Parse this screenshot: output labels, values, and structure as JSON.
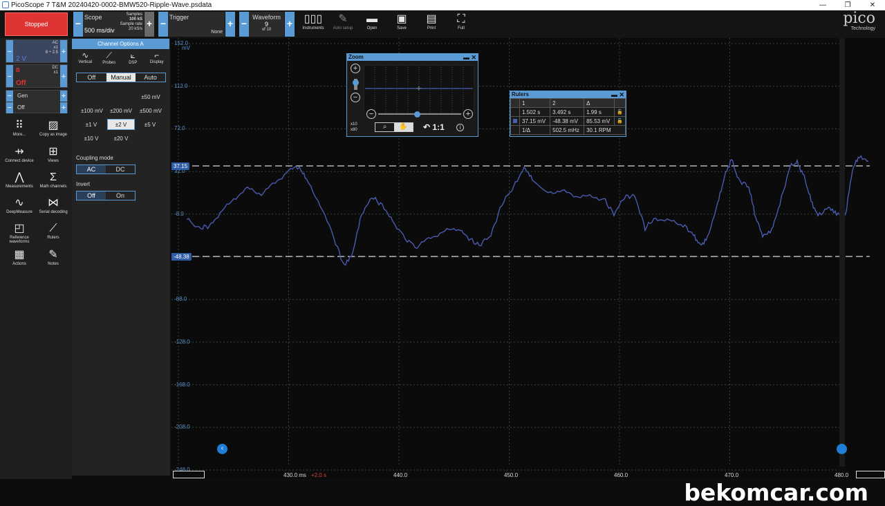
{
  "window": {
    "title": "PicoScope 7 T&M 20240420-0002-BMW520-Ripple-Wave.psdata",
    "min": "—",
    "restore": "❐",
    "close": "✕"
  },
  "toolbar": {
    "status": "Stopped",
    "scope": {
      "label": "Scope",
      "timebase": "500 ms/div",
      "samples_label": "Samples",
      "samples": "100 kS",
      "rate_label": "Sample rate",
      "rate": "20 kS/s"
    },
    "trigger": {
      "label": "Trigger",
      "mode": "None"
    },
    "waveform": {
      "label": "Waveform",
      "index": "9",
      "of": "of 10"
    },
    "tools": [
      "Instruments",
      "Auto setup",
      "Open",
      "Save",
      "Print",
      "Full"
    ],
    "brand": "pico",
    "brand_sub": "Technology"
  },
  "channels": {
    "a": {
      "coupling": "AC",
      "probe": "x1",
      "offset": "8 ÷ 2.5",
      "range": "2 V"
    },
    "b": {
      "letter": "B",
      "coupling": "DC",
      "probe": "x1",
      "state": "Off"
    },
    "gen": {
      "label": "Gen",
      "state": "Off"
    }
  },
  "nav": [
    {
      "label": "More..."
    },
    {
      "label": "Copy as image"
    },
    {
      "label": "Connect device"
    },
    {
      "label": "Views"
    },
    {
      "label": "Measurements"
    },
    {
      "label": "Math channels"
    },
    {
      "label": "DeepMeasure"
    },
    {
      "label": "Serial decoding"
    },
    {
      "label": "Reference waveforms"
    },
    {
      "label": "Rulers"
    },
    {
      "label": "Actions"
    },
    {
      "label": "Notes"
    }
  ],
  "channel_options": {
    "title": "Channel Options  A",
    "tabs": [
      "Vertical",
      "Probes",
      "DSP",
      "Display"
    ],
    "mode": [
      "Off",
      "Manual",
      "Auto"
    ],
    "mode_selected": "Manual",
    "ranges": [
      "±50 mV",
      "±100 mV",
      "±200 mV",
      "±500 mV",
      "±1 V",
      "±2 V",
      "±5 V",
      "±10 V",
      "±20 V"
    ],
    "range_selected": "±2 V",
    "coupling_label": "Coupling mode",
    "coupling": [
      "AC",
      "DC"
    ],
    "invert_label": "Invert",
    "invert": [
      "Off",
      "On"
    ]
  },
  "scope": {
    "unit": "mV",
    "y_ticks": [
      "152.0",
      "112.0",
      "72.0",
      "32.0",
      "-8.0",
      "-48.0",
      "-88.0",
      "-128.0",
      "-168.0",
      "-208.0",
      "-248.0"
    ],
    "x_ticks": [
      "430.0 ms",
      "440.0",
      "450.0",
      "460.0",
      "470.0",
      "480.0"
    ],
    "x_offset": "+2.0 s",
    "ruler1": "37.15",
    "ruler2": "-48.38",
    "waveform_color": "#4a5bb0"
  },
  "zoom": {
    "title": "Zoom",
    "x1": "x10",
    "x2": "x80",
    "reset": "1:1"
  },
  "rulers": {
    "title": "Rulers",
    "head": [
      "1",
      "2",
      "Δ"
    ],
    "row1": [
      "1.502 s",
      "3.492 s",
      "1.99 s"
    ],
    "row2": [
      "37.15 mV",
      "-48.38 mV",
      "85.53 mV"
    ],
    "row3": [
      "1/Δ",
      "502.5 mHz",
      "30.1 RPM"
    ]
  },
  "watermark": "bekomcar.com"
}
